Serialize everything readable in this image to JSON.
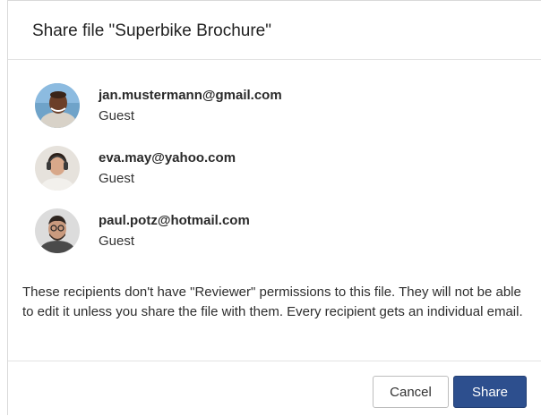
{
  "dialog": {
    "title": "Share file \"Superbike Brochure\""
  },
  "recipients": [
    {
      "email": "jan.mustermann@gmail.com",
      "role": "Guest"
    },
    {
      "email": "eva.may@yahoo.com",
      "role": "Guest"
    },
    {
      "email": "paul.potz@hotmail.com",
      "role": "Guest"
    }
  ],
  "notice": "These recipients don't have \"Reviewer\" permissions to this file. They will not be able to edit it unless you share the file with them. Every recipient gets an individual email.",
  "buttons": {
    "cancel_label": "Cancel",
    "share_label": "Share"
  },
  "colors": {
    "primary": "#2d4f8e",
    "text": "#2a2a2a",
    "border": "#d9d9d9"
  }
}
